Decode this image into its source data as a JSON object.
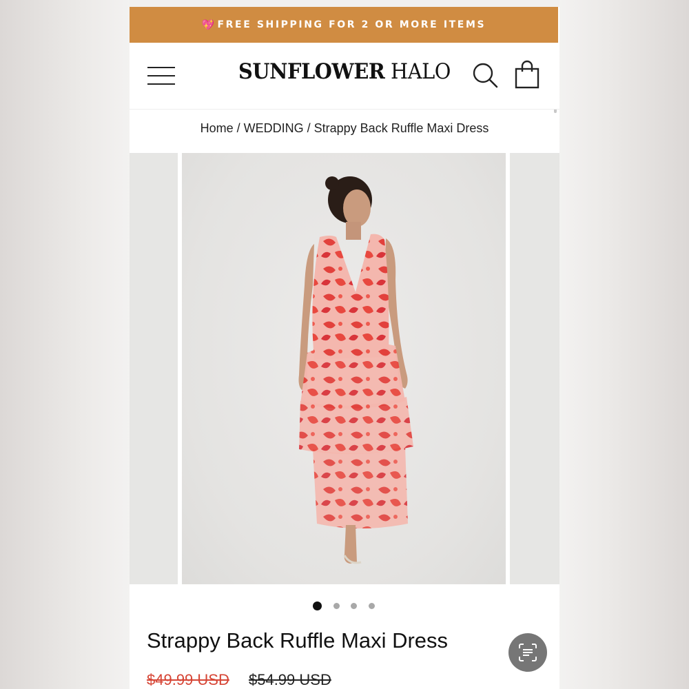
{
  "promo": {
    "icon": "heart-icon",
    "text": "FREE SHIPPING FOR 2 OR MORE ITEMS",
    "bg": "#d08c42"
  },
  "brand": {
    "name_bold": "SUNFLOWER",
    "name_light": "HALO"
  },
  "breadcrumb": [
    {
      "label": "Home"
    },
    {
      "label": "WEDDING"
    },
    {
      "label": "Strappy Back Ruffle Maxi Dress"
    }
  ],
  "breadcrumb_separator": "/",
  "gallery": {
    "image_count": 4,
    "active_index": 0
  },
  "product": {
    "title": "Strappy Back Ruffle Maxi Dress",
    "sale_price": "$49.99 USD",
    "original_price": "$54.99 USD",
    "sale_color": "#d64535"
  }
}
